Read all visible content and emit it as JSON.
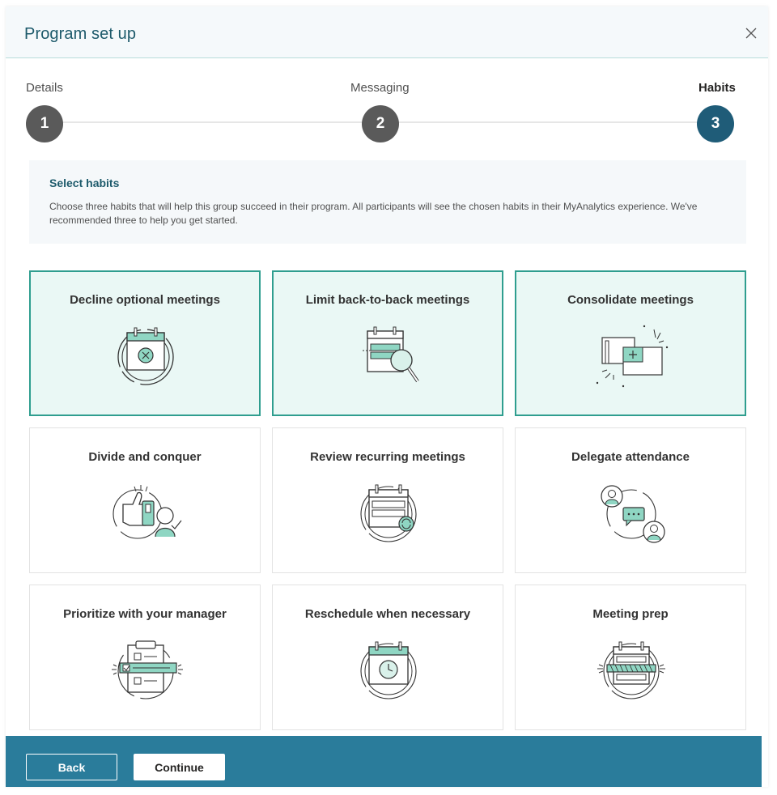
{
  "dialog": {
    "title": "Program set up",
    "close_icon": "close-icon"
  },
  "stepper": {
    "steps": [
      {
        "label": "Details",
        "number": "1",
        "state": "complete"
      },
      {
        "label": "Messaging",
        "number": "2",
        "state": "complete"
      },
      {
        "label": "Habits",
        "number": "3",
        "state": "current"
      }
    ]
  },
  "info": {
    "title": "Select habits",
    "text": "Choose three habits that will help this group succeed in their program. All participants will see the chosen habits in their MyAnalytics experience. We've recommended three to help you get started."
  },
  "habits": [
    {
      "title": "Decline optional meetings",
      "icon": "calendar-decline-icon",
      "selected": true
    },
    {
      "title": "Limit back-to-back meetings",
      "icon": "calendar-search-icon",
      "selected": true
    },
    {
      "title": "Consolidate meetings",
      "icon": "consolidate-icon",
      "selected": true
    },
    {
      "title": "Divide and conquer",
      "icon": "thumbs-up-person-icon",
      "selected": false
    },
    {
      "title": "Review recurring meetings",
      "icon": "calendar-recurring-icon",
      "selected": false
    },
    {
      "title": "Delegate attendance",
      "icon": "people-chat-icon",
      "selected": false
    },
    {
      "title": "Prioritize with your manager",
      "icon": "clipboard-icon",
      "selected": false
    },
    {
      "title": "Reschedule when necessary",
      "icon": "calendar-clock-icon",
      "selected": false
    },
    {
      "title": "Meeting prep",
      "icon": "calendar-prep-icon",
      "selected": false
    }
  ],
  "footer": {
    "back_label": "Back",
    "continue_label": "Continue"
  },
  "colors": {
    "accent": "#1d5a6b",
    "step_active": "#1f5c78",
    "step_done": "#5a5a5a",
    "selected_bg": "#eaf8f5",
    "selected_border": "#2f9e8f",
    "footer": "#2a7c9b"
  }
}
